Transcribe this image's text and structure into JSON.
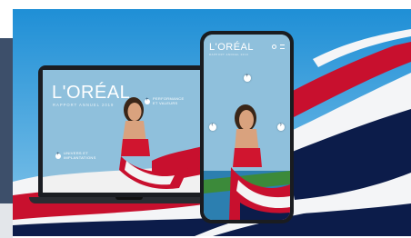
{
  "brand": {
    "logo_text": "L'ORÉAL",
    "subtitle": "RAPPORT ANNUEL 2019"
  },
  "laptop": {
    "hotspots": [
      {
        "label": "PERFORMANCE\nET VALEURS"
      },
      {
        "label": "UNIVERS ET\nIMPLANTATIONS"
      }
    ]
  },
  "phone": {
    "icons": [
      "search-icon",
      "menu-icon"
    ],
    "nav": [
      "plus-icon",
      "chevron-left-icon",
      "chevron-right-icon"
    ]
  },
  "colors": {
    "sky": "#3aa2e0",
    "flag_red": "#c8102e",
    "flag_navy": "#0c1c4a",
    "left_band": "#3d4f6a"
  }
}
